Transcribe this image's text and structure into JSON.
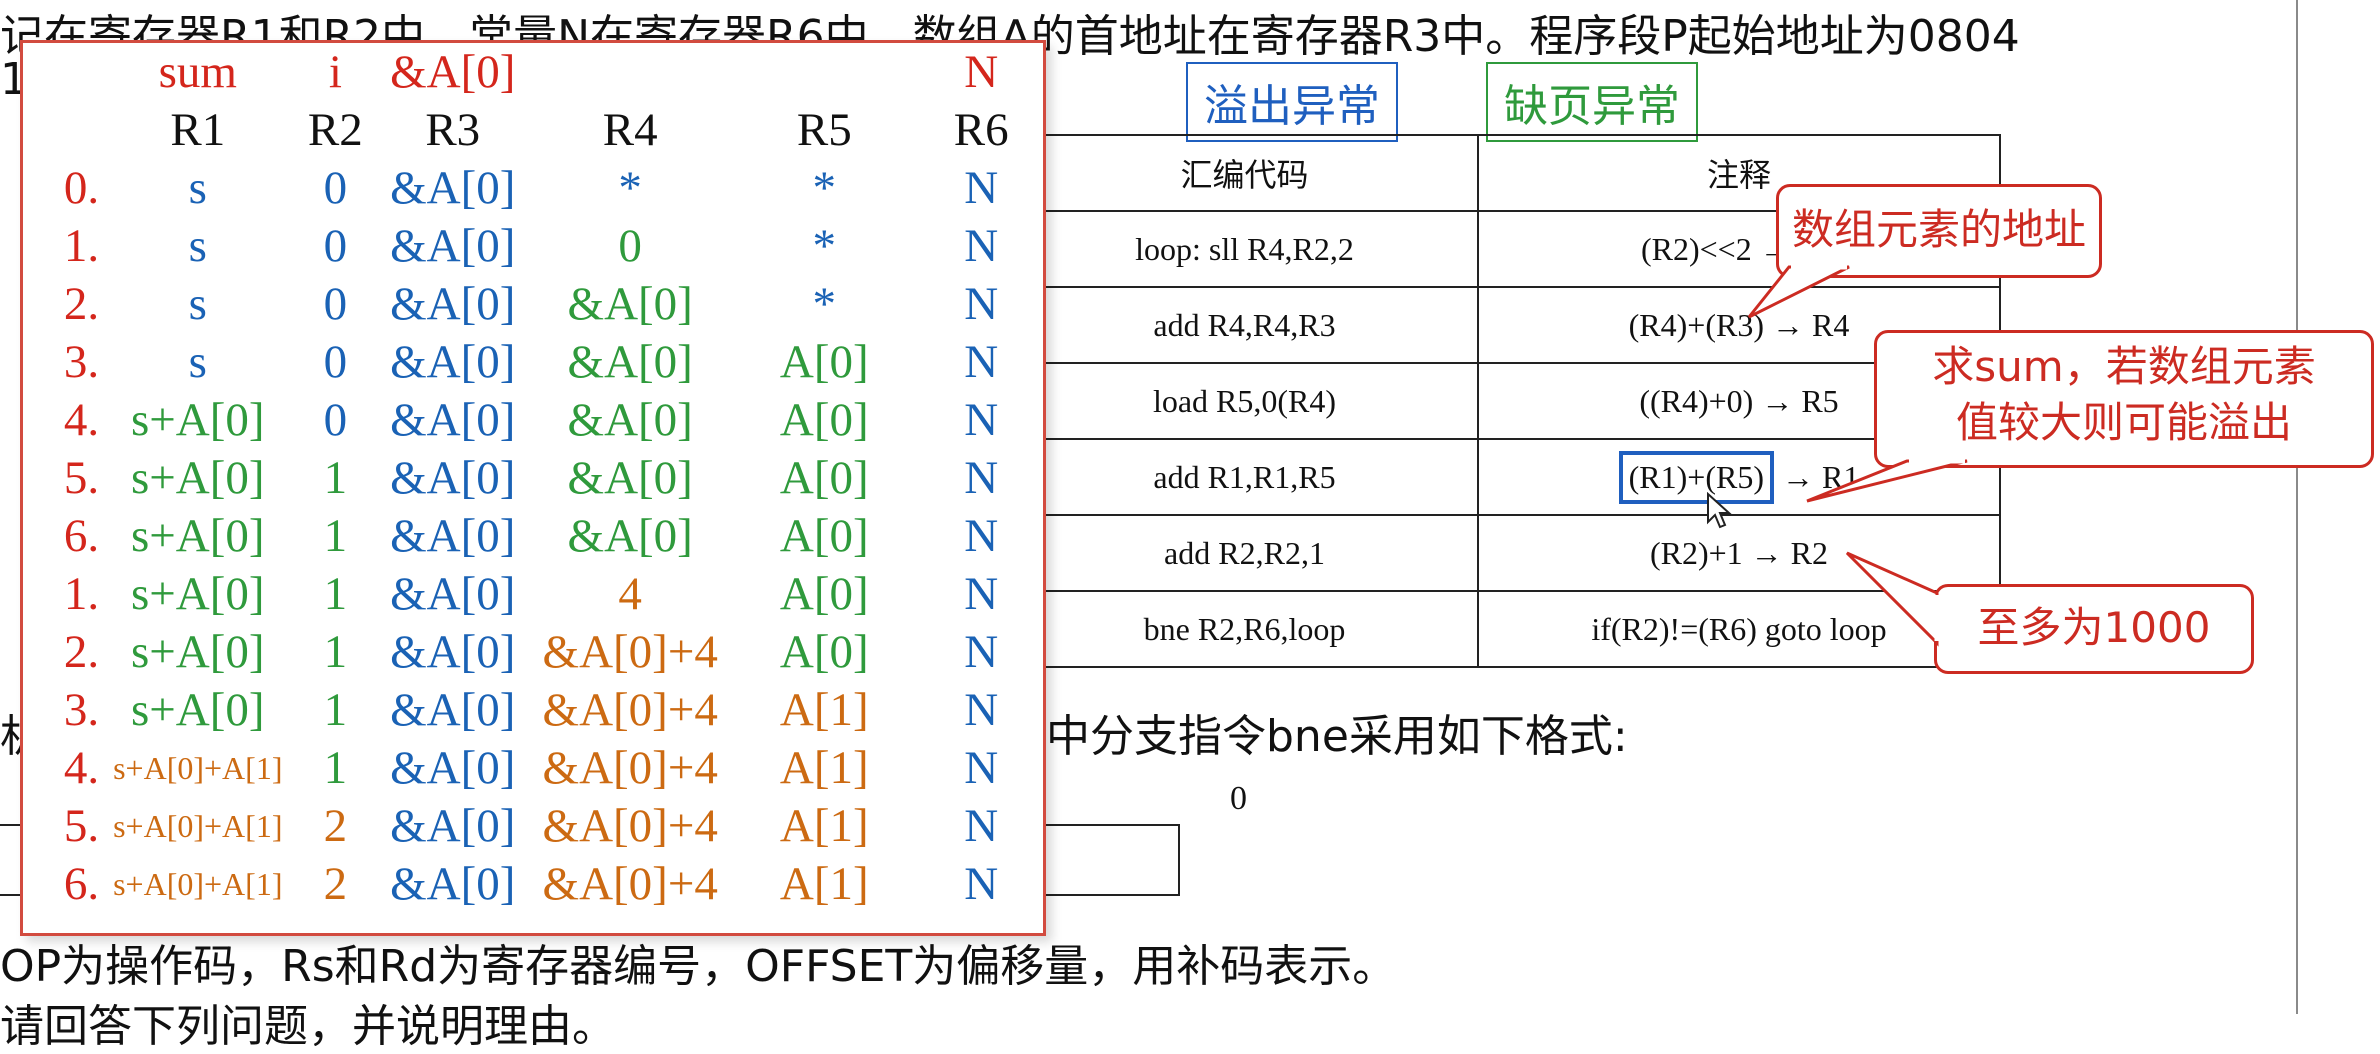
{
  "background": {
    "top_line": "记在寄存器R1和R2中，常量N在寄存器R6中，数组A的首地址在寄存器R3中。程序段P起始地址为0804",
    "line2_fragment": "1",
    "mid_line": "中分支指令bne采用如下格式:",
    "left_fragment": "机",
    "zero_label": "0",
    "bottom_line": "OP为操作码，Rs和Rd为寄存器编号，OFFSET为偏移量，用补码表示。",
    "last_line": "请回答下列问题，并说明理由。"
  },
  "tags": {
    "overflow": "溢出异常",
    "page_fault": "缺页异常"
  },
  "code_table": {
    "header": {
      "code": "汇编代码",
      "comment": "注释"
    },
    "rows": [
      {
        "code": "loop: sll R4,R2,2",
        "comment": "(R2)<<2 → R4"
      },
      {
        "code": "add R4,R4,R3",
        "comment": "(R4)+(R3) → R4"
      },
      {
        "code": "load R5,0(R4)",
        "comment": "((R4)+0) → R5"
      },
      {
        "code": "add R1,R1,R5",
        "comment_hl": "(R1)+(R5)",
        "comment_tail": " → R1"
      },
      {
        "code": "add R2,R2,1",
        "comment": "(R2)+1 → R2"
      },
      {
        "code": "bne R2,R6,loop",
        "comment": "if(R2)!=(R6) goto loop"
      }
    ]
  },
  "callouts": {
    "address": "数组元素的地址",
    "sum_line1": "求sum，若数组元素",
    "sum_line2": "值较大则可能溢出",
    "max": "至多为1000"
  },
  "panel": {
    "names": [
      "",
      "sum",
      "i",
      "&A[0]",
      "",
      "",
      "N"
    ],
    "registers": [
      "",
      "R1",
      "R2",
      "R3",
      "R4",
      "R5",
      "R6"
    ],
    "rows": [
      {
        "step": "0.",
        "r1": "s",
        "r2": "0",
        "r3": "&A[0]",
        "r4": "*",
        "r5": "*",
        "r6": "N",
        "c1": "blue",
        "c2": "blue",
        "c4": "blue",
        "c5": "blue",
        "s1": false
      },
      {
        "step": "1.",
        "r1": "s",
        "r2": "0",
        "r3": "&A[0]",
        "r4": "0",
        "r5": "*",
        "r6": "N",
        "c1": "blue",
        "c2": "blue",
        "c4": "green",
        "c5": "blue",
        "s1": false
      },
      {
        "step": "2.",
        "r1": "s",
        "r2": "0",
        "r3": "&A[0]",
        "r4": "&A[0]",
        "r5": "*",
        "r6": "N",
        "c1": "blue",
        "c2": "blue",
        "c4": "green",
        "c5": "blue",
        "s1": false
      },
      {
        "step": "3.",
        "r1": "s",
        "r2": "0",
        "r3": "&A[0]",
        "r4": "&A[0]",
        "r5": "A[0]",
        "r6": "N",
        "c1": "blue",
        "c2": "blue",
        "c4": "green",
        "c5": "green",
        "s1": false
      },
      {
        "step": "4.",
        "r1": "s+A[0]",
        "r2": "0",
        "r3": "&A[0]",
        "r4": "&A[0]",
        "r5": "A[0]",
        "r6": "N",
        "c1": "green",
        "c2": "blue",
        "c4": "green",
        "c5": "green",
        "s1": false
      },
      {
        "step": "5.",
        "r1": "s+A[0]",
        "r2": "1",
        "r3": "&A[0]",
        "r4": "&A[0]",
        "r5": "A[0]",
        "r6": "N",
        "c1": "green",
        "c2": "green",
        "c4": "green",
        "c5": "green",
        "s1": false
      },
      {
        "step": "6.",
        "r1": "s+A[0]",
        "r2": "1",
        "r3": "&A[0]",
        "r4": "&A[0]",
        "r5": "A[0]",
        "r6": "N",
        "c1": "green",
        "c2": "green",
        "c4": "green",
        "c5": "green",
        "s1": false
      },
      {
        "step": "1.",
        "r1": "s+A[0]",
        "r2": "1",
        "r3": "&A[0]",
        "r4": "4",
        "r5": "A[0]",
        "r6": "N",
        "c1": "green",
        "c2": "green",
        "c4": "orange",
        "c5": "green",
        "s1": false
      },
      {
        "step": "2.",
        "r1": "s+A[0]",
        "r2": "1",
        "r3": "&A[0]",
        "r4": "&A[0]+4",
        "r5": "A[0]",
        "r6": "N",
        "c1": "green",
        "c2": "green",
        "c4": "orange",
        "c5": "green",
        "s1": false
      },
      {
        "step": "3.",
        "r1": "s+A[0]",
        "r2": "1",
        "r3": "&A[0]",
        "r4": "&A[0]+4",
        "r5": "A[1]",
        "r6": "N",
        "c1": "green",
        "c2": "green",
        "c4": "orange",
        "c5": "orange",
        "s1": false
      },
      {
        "step": "4.",
        "r1": "s+A[0]+A[1]",
        "r2": "1",
        "r3": "&A[0]",
        "r4": "&A[0]+4",
        "r5": "A[1]",
        "r6": "N",
        "c1": "orange",
        "c2": "green",
        "c4": "orange",
        "c5": "orange",
        "s1": true
      },
      {
        "step": "5.",
        "r1": "s+A[0]+A[1]",
        "r2": "2",
        "r3": "&A[0]",
        "r4": "&A[0]+4",
        "r5": "A[1]",
        "r6": "N",
        "c1": "orange",
        "c2": "orange",
        "c4": "orange",
        "c5": "orange",
        "s1": true
      },
      {
        "step": "6.",
        "r1": "s+A[0]+A[1]",
        "r2": "2",
        "r3": "&A[0]",
        "r4": "&A[0]+4",
        "r5": "A[1]",
        "r6": "N",
        "c1": "orange",
        "c2": "orange",
        "c4": "orange",
        "c5": "orange",
        "s1": true
      }
    ]
  },
  "colors": {
    "red": "#d4261c",
    "blue": "#1a62b5",
    "green": "#2f9a3c",
    "orange": "#cc6a12",
    "tag_blue": "#1f5fbf",
    "tag_green": "#2f9a3c",
    "callout": "#cc2b22"
  }
}
